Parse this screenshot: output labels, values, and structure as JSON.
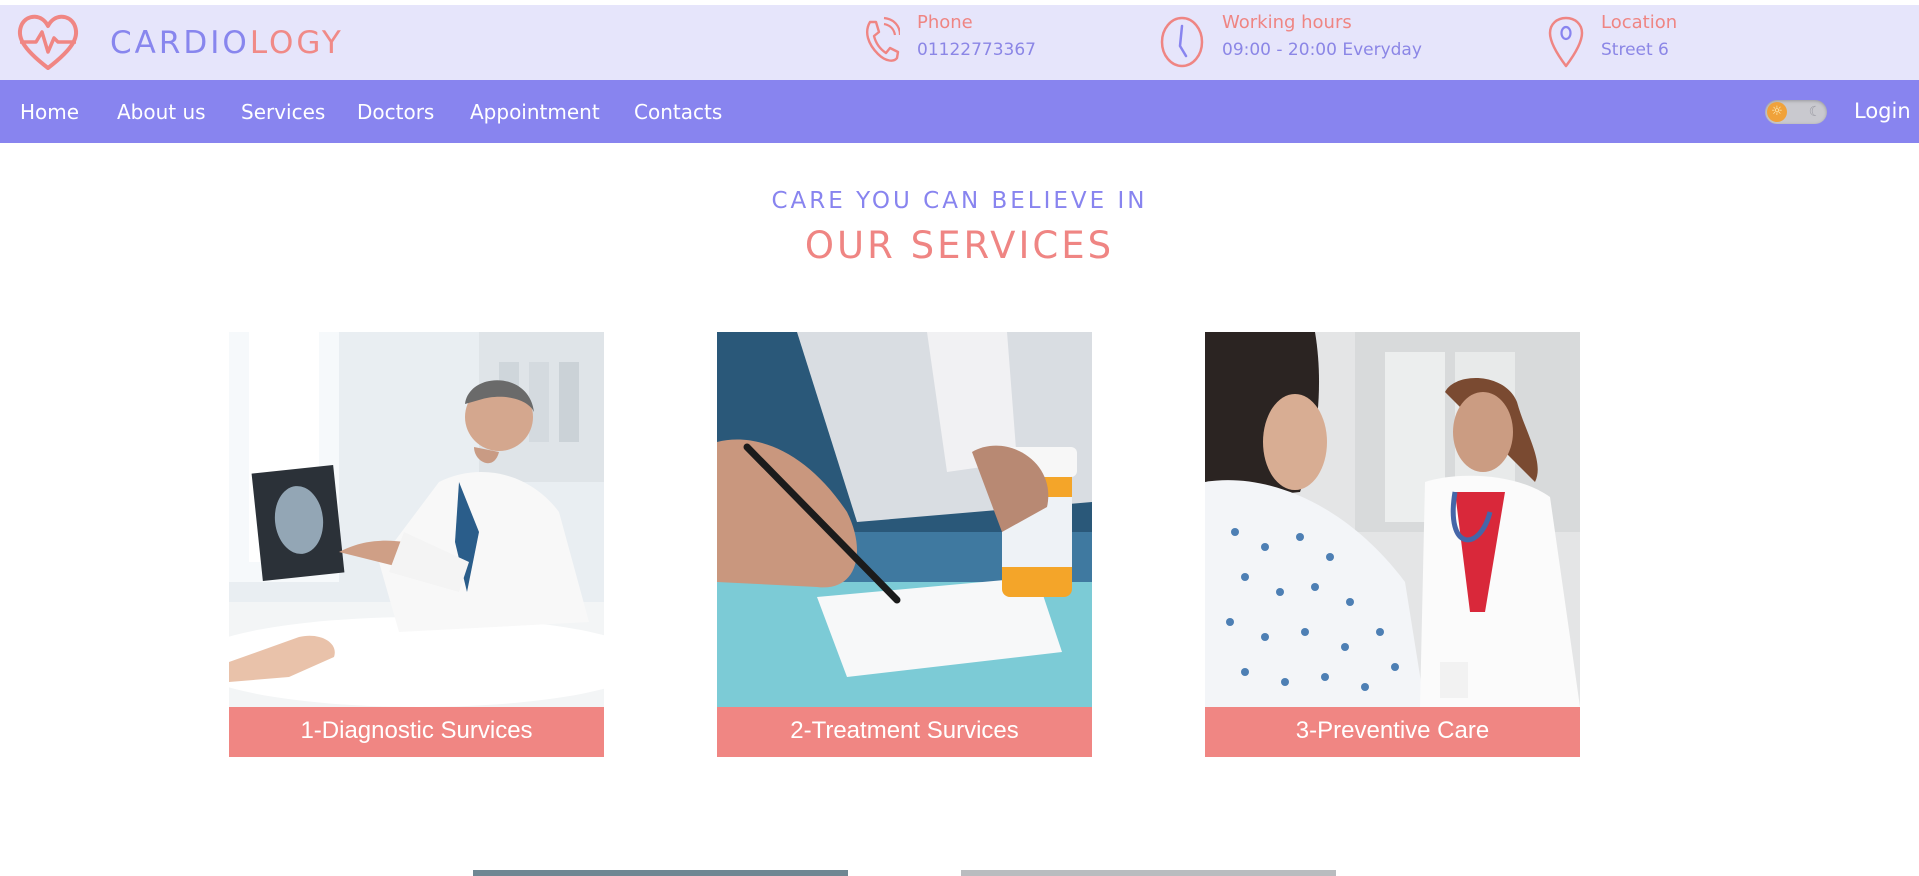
{
  "brand": {
    "part1": "CARDIO",
    "part2": "LOGY"
  },
  "contact": {
    "phone": {
      "label": "Phone",
      "value": "01122773367"
    },
    "hours": {
      "label": "Working hours",
      "value": "09:00 - 20:00 Everyday"
    },
    "location": {
      "label": "Location",
      "value": "Street 6"
    }
  },
  "nav": {
    "items": [
      "Home",
      "About us",
      "Services",
      "Doctors",
      "Appointment",
      "Contacts"
    ],
    "login": "Login",
    "theme_toggle": {
      "state": "light",
      "icons": [
        "sun-icon",
        "moon-icon"
      ]
    }
  },
  "section": {
    "subtitle": "CARE YOU CAN BELIEVE IN",
    "title": "OUR SERVICES"
  },
  "services": [
    {
      "caption": "1-Diagnostic Survices",
      "image": "doctor-reviewing-xray"
    },
    {
      "caption": "2-Treatment Survices",
      "image": "doctor-writing-prescription"
    },
    {
      "caption": "3-Preventive Care",
      "image": "doctor-with-patient"
    }
  ],
  "colors": {
    "topbar_bg": "#e6e5fb",
    "nav_bg": "#8884ef",
    "accent_pink": "#f08683",
    "accent_purple": "#8884ef"
  }
}
